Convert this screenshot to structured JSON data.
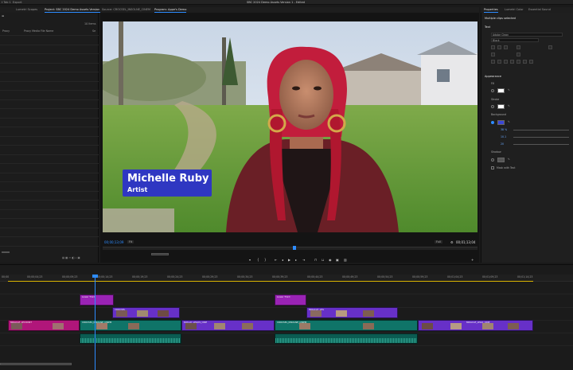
{
  "app": {
    "title": "SBC 2024 Demo Assets Version 1 - Edited",
    "menu": [
      "t Tab 1",
      "Export"
    ],
    "left_tabs": [
      "Lumetri Scopes",
      "Project: SBC 2024 Demo Assets Version 1"
    ],
    "source_tab": "Source: CROCSEL_INSOLNE_CINEM",
    "program_tab": "Program: Appe's Demo",
    "right_tabs": [
      "Properties",
      "Lumetri Color",
      "Essential Sound"
    ]
  },
  "project": {
    "items_count": "10 Items",
    "col_proxy": "Proxy",
    "col_name": "Proxy Media File Name",
    "col_fps": "Se"
  },
  "program": {
    "lower_third_name": "Michelle Ruby",
    "lower_third_role": "Artist",
    "timecode_current": "00;00;13;09",
    "fit": "Fit",
    "quality": "Full",
    "timecode_total": "00;01;13;04"
  },
  "properties": {
    "header": "Multiple clips selected",
    "text_section": "Text",
    "font": "Adobe Clean",
    "font_style": "Black",
    "appearance": "Appearance",
    "fill": "Fill",
    "stroke": "Stroke",
    "background": "Background",
    "bg_opacity": "38 %",
    "bg_size": "10.1",
    "bg_corner": "20",
    "shadow": "Shadow",
    "mask_with_text": "Mask with Text",
    "colors": {
      "fill": "#ffffff",
      "stroke": "#ffffff",
      "background": "#3a46d6",
      "shadow": "#555555",
      "accent": "#2e8cff"
    }
  },
  "timeline": {
    "ruler": [
      "00;00",
      "00;00;04;23",
      "00;00;09;23",
      "00;00;14;23",
      "00;00;19;23",
      "00;00;24;23",
      "00;00;29;23",
      "00;00;34;23",
      "00;00;39;23",
      "00;00;44;23",
      "00;00;49;23",
      "00;00;54;23",
      "00;00;59;23",
      "00;01;04;23",
      "00;01;09;23",
      "00;01;14;23"
    ],
    "clips": {
      "t1": "Lower Third",
      "t2": "Lower Third",
      "c1": "MIRACLE_LECOUNT",
      "c2": "MIRACLE_LECOUNT",
      "c3": "CROCSEL_INSOLNE_CINEM",
      "c4": "CROCSEL_INS",
      "c5": "RAYLAY_LEGOS_CINE",
      "c6": "CROCSEL",
      "c7": "LAYLAY_GOLD",
      "c8": "CROCSEL_INSOLNE_CINEM",
      "c9": "MIRACLE_LEG",
      "c10": "MIRACLE_LEGO",
      "c11": "MIRACLE_LEGO_CINE"
    }
  }
}
